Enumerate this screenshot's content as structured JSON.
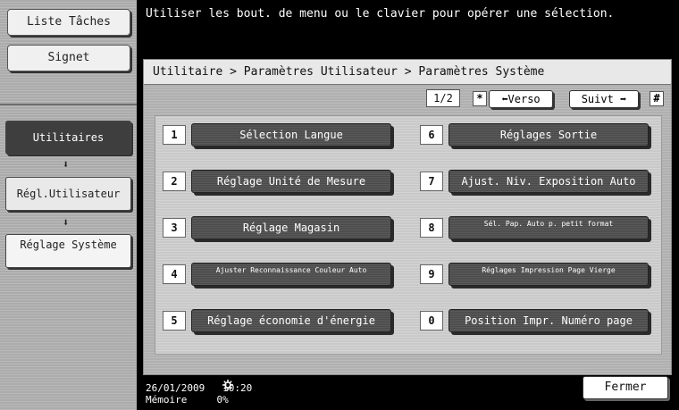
{
  "top_message": "Utiliser les bout. de menu ou le clavier pour opérer une sélection.",
  "sidebar": {
    "liste_taches": "Liste Tâches",
    "signet": "Signet",
    "nav": [
      {
        "label": "Utilitaires"
      },
      {
        "label": "Régl.Utilisateur"
      },
      {
        "label": "Réglage Système"
      }
    ],
    "arrow_glyph": "⬇"
  },
  "breadcrumb": "Utilitaire > Paramètres Utilisateur > Paramètres Système",
  "pager": {
    "page": "1/2",
    "star": "*",
    "verso_label": "⬅Verso",
    "suivt_label": "Suivt ➡",
    "hash": "#"
  },
  "menu": [
    {
      "num": "1",
      "label": "Sélection Langue"
    },
    {
      "num": "2",
      "label": "Réglage Unité de Mesure"
    },
    {
      "num": "3",
      "label": "Réglage Magasin"
    },
    {
      "num": "4",
      "label": "Ajuster Reconnaissance Couleur Auto"
    },
    {
      "num": "5",
      "label": "Réglage économie d'énergie"
    },
    {
      "num": "6",
      "label": "Réglages Sortie"
    },
    {
      "num": "7",
      "label": "Ajust. Niv. Exposition Auto"
    },
    {
      "num": "8",
      "label": "Sél. Pap. Auto p. petit format"
    },
    {
      "num": "9",
      "label": "Réglages Impression Page Vierge"
    },
    {
      "num": "0",
      "label": "Position Impr. Numéro page"
    }
  ],
  "status": {
    "date": "26/01/2009",
    "time": "10:20",
    "memory_label": "Mémoire",
    "memory_value": "0%",
    "icon": "gear-icon"
  },
  "fermer_label": "Fermer"
}
